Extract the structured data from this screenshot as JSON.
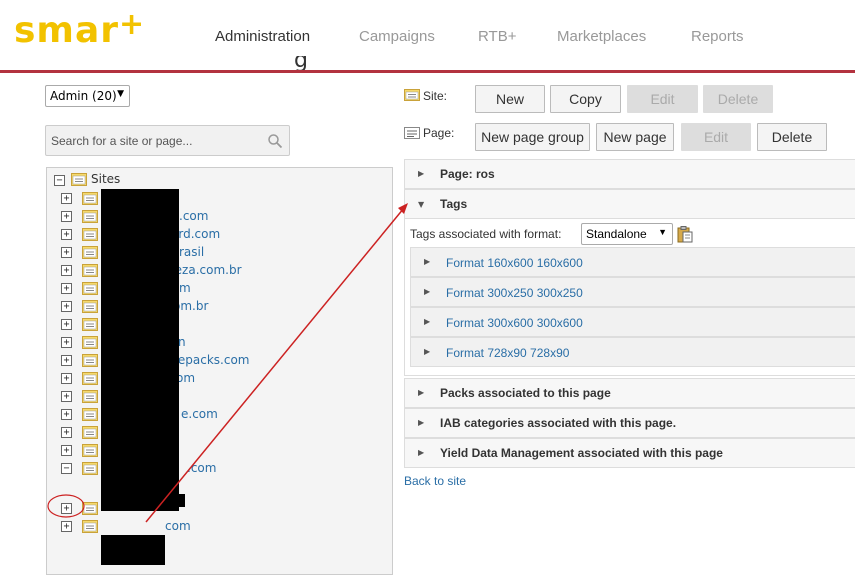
{
  "header": {
    "logo_text": "smar",
    "logo_plus": "+",
    "page_title_fragment": "g",
    "nav": [
      {
        "label": "Administration",
        "active": true
      },
      {
        "label": "Campaigns",
        "active": false
      },
      {
        "label": "RTB+",
        "active": false
      },
      {
        "label": "Marketplaces",
        "active": false
      },
      {
        "label": "Reports",
        "active": false
      }
    ],
    "accent_color": "#b3323f",
    "logo_color": "#f2c200"
  },
  "left": {
    "admin_select": "Admin (20)",
    "search_placeholder": "Search for a site or page...",
    "tree_root": "Sites",
    "sites": [
      {
        "visible_text": ""
      },
      {
        "visible_text": ".com"
      },
      {
        "visible_text": "ard.com"
      },
      {
        "visible_text": "rasil"
      },
      {
        "visible_text": "reza.com.br"
      },
      {
        "visible_text": "m"
      },
      {
        "visible_text": "om.br"
      },
      {
        "visible_text": ""
      },
      {
        "visible_text": "n"
      },
      {
        "visible_text": "urcepacks.com"
      },
      {
        "visible_text": "om"
      },
      {
        "visible_text": ""
      },
      {
        "visible_text": "e.com"
      },
      {
        "visible_text": ""
      },
      {
        "visible_text": ""
      },
      {
        "visible_text": ".com",
        "expanded": true,
        "pages": [
          "ros"
        ]
      },
      {
        "visible_text": ""
      },
      {
        "visible_text": "com"
      }
    ]
  },
  "right": {
    "site_label": "Site:",
    "page_label": "Page:",
    "site_buttons": [
      {
        "label": "New",
        "disabled": false
      },
      {
        "label": "Copy",
        "disabled": false
      },
      {
        "label": "Edit",
        "disabled": true
      },
      {
        "label": "Delete",
        "disabled": true
      }
    ],
    "page_buttons": [
      {
        "label": "New page group",
        "disabled": false
      },
      {
        "label": "New page",
        "disabled": false
      },
      {
        "label": "Edit",
        "disabled": true
      },
      {
        "label": "Delete",
        "disabled": false
      }
    ],
    "panels": {
      "page": "Page: ros",
      "tags": "Tags",
      "packs": "Packs associated to this page",
      "iab": "IAB categories associated with this page.",
      "yield": "Yield Data Management associated with this page"
    },
    "tags_format_label": "Tags associated with format:",
    "tags_format_value": "Standalone",
    "formats": [
      "Format 160x600 160x600",
      "Format 300x250 300x250",
      "Format 300x600 300x600",
      "Format 728x90 728x90"
    ],
    "back_link": "Back to site"
  },
  "icons": [
    "search-icon",
    "site-icon",
    "page-icon",
    "paste-icon",
    "expand-icon",
    "collapse-icon"
  ],
  "annotation_color": "#cc2222"
}
